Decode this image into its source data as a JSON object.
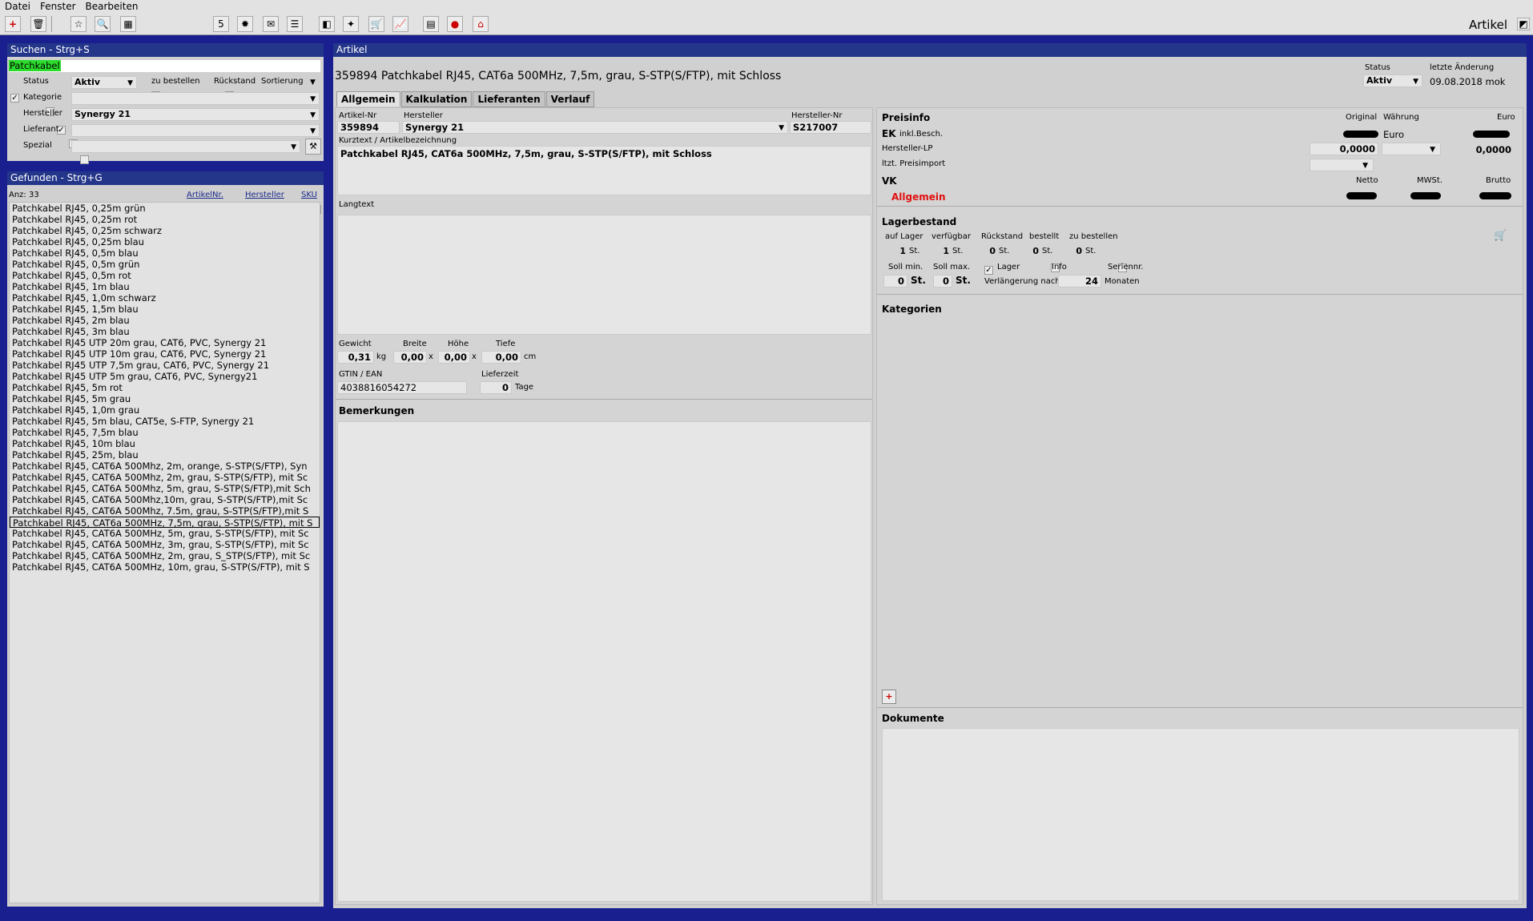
{
  "menu": [
    "Datei",
    "Fenster",
    "Bearbeiten"
  ],
  "app_title": "Artikel",
  "search": {
    "header": "Suchen - Strg+S",
    "query": "Patchkabel",
    "status_label": "Status",
    "status_value": "Aktiv",
    "zu_bestellen": "zu bestellen",
    "rueckstand": "Rückstand",
    "sortierung": "Sortierung",
    "kategorie": "Kategorie",
    "hersteller": "Hersteller",
    "hersteller_value": "Synergy 21",
    "lieferant": "Lieferant",
    "spezial": "Spezial"
  },
  "found": {
    "header": "Gefunden - Strg+G",
    "count": "Anz: 33",
    "col_artnr": "ArtikelNr.",
    "col_hersteller": "Hersteller",
    "col_sku": "SKU",
    "items": [
      "Patchkabel RJ45, 0,25m grün",
      "Patchkabel RJ45, 0,25m rot",
      "Patchkabel RJ45, 0,25m schwarz",
      "Patchkabel RJ45, 0,25m blau",
      "Patchkabel RJ45, 0,5m blau",
      "Patchkabel RJ45, 0,5m grün",
      "Patchkabel RJ45, 0,5m rot",
      "Patchkabel RJ45, 1m blau",
      "Patchkabel RJ45, 1,0m schwarz",
      "Patchkabel RJ45, 1,5m blau",
      "Patchkabel RJ45, 2m blau",
      "Patchkabel RJ45, 3m blau",
      "Patchkabel RJ45 UTP 20m grau, CAT6, PVC, Synergy 21",
      "Patchkabel RJ45 UTP 10m grau, CAT6, PVC, Synergy 21",
      "Patchkabel RJ45 UTP 7,5m grau, CAT6, PVC, Synergy 21",
      "Patchkabel RJ45 UTP 5m grau, CAT6, PVC, Synergy21",
      "Patchkabel RJ45, 5m rot",
      "Patchkabel RJ45, 5m grau",
      "Patchkabel RJ45, 1,0m grau",
      "Patchkabel RJ45, 5m blau, CAT5e, S-FTP, Synergy 21",
      "Patchkabel RJ45, 7,5m blau",
      "Patchkabel RJ45, 10m blau",
      "Patchkabel RJ45, 25m, blau",
      "Patchkabel RJ45, CAT6A 500Mhz, 2m, orange, S-STP(S/FTP), Syn",
      "Patchkabel RJ45, CAT6A 500Mhz, 2m, grau, S-STP(S/FTP), mit Sc",
      "Patchkabel RJ45, CAT6A 500Mhz, 5m, grau, S-STP(S/FTP),mit Sch",
      "Patchkabel RJ45, CAT6A 500Mhz,10m, grau, S-STP(S/FTP),mit Sc",
      "Patchkabel RJ45, CAT6A 500Mhz, 7.5m, grau, S-STP(S/FTP),mit S",
      "Patchkabel RJ45, CAT6a 500MHz, 7,5m, grau, S-STP(S/FTP), mit S",
      "Patchkabel RJ45, CAT6A 500MHz, 5m, grau, S-STP(S/FTP), mit Sc",
      "Patchkabel RJ45, CAT6A 500MHz, 3m, grau, S-STP(S/FTP), mit Sc",
      "Patchkabel RJ45, CAT6A 500MHz, 2m, grau, S_STP(S/FTP), mit Sc",
      "Patchkabel RJ45, CAT6A 500MHz, 10m, grau, S-STP(S/FTP), mit S"
    ],
    "selected_index": 28
  },
  "article": {
    "header": "Artikel",
    "title": "359894 Patchkabel RJ45, CAT6a 500MHz, 7,5m, grau, S-STP(S/FTP), mit Schloss",
    "status_label": "Status",
    "status_value": "Aktiv",
    "last_change_label": "letzte Änderung",
    "last_change_value": "09.08.2018 mok",
    "tabs": [
      "Allgemein",
      "Kalkulation",
      "Lieferanten",
      "Verlauf"
    ],
    "artnr_label": "Artikel-Nr",
    "artnr": "359894",
    "hersteller_label": "Hersteller",
    "hersteller": "Synergy 21",
    "herstnr_label": "Hersteller-Nr",
    "herstnr": "S217007",
    "kurztext_label": "Kurztext / Artikelbezeichnung",
    "kurztext": "Patchkabel RJ45, CAT6a 500MHz, 7,5m, grau, S-STP(S/FTP), mit Schloss",
    "langtext_label": "Langtext",
    "gewicht_label": "Gewicht",
    "gewicht": "0,31",
    "kg": "kg",
    "breite_label": "Breite",
    "breite": "0,00",
    "hoehe_label": "Höhe",
    "hoehe": "0,00",
    "tiefe_label": "Tiefe",
    "tiefe": "0,00",
    "cm": "cm",
    "x": "x",
    "gtin_label": "GTIN / EAN",
    "gtin": "4038816054272",
    "lieferzeit_label": "Lieferzeit",
    "lieferzeit": "0",
    "tage": "Tage",
    "bemerkungen": "Bemerkungen"
  },
  "preis": {
    "title": "Preisinfo",
    "original": "Original",
    "waehrung": "Währung",
    "euro": "Euro",
    "ek": "EK",
    "inkl": "inkl.Besch.",
    "ek_currency": "Euro",
    "herst_lp": "Hersteller-LP",
    "herst_lp_value": "0,0000",
    "herst_lp_euro": "0,0000",
    "letzt_import": "ltzt. Preisimport",
    "vk": "VK",
    "netto": "Netto",
    "mwst": "MWSt.",
    "brutto": "Brutto",
    "allgemein": "Allgemein",
    "allgemein_color": "#e01010"
  },
  "lager": {
    "title": "Lagerbestand",
    "auf_lager": "auf Lager",
    "verfuegbar": "verfügbar",
    "rueckstand": "Rückstand",
    "bestellt": "bestellt",
    "zu_bestellen": "zu bestellen",
    "v_auf_lager": "1",
    "v_verfuegbar": "1",
    "v_rueckstand": "0",
    "v_bestellt": "0",
    "v_zu_bestellen": "0",
    "st": "St.",
    "soll_min": "Soll min.",
    "soll_max": "Soll max.",
    "v_soll_min": "0",
    "v_soll_max": "0",
    "lager": "Lager",
    "info": "Info",
    "seriennr": "Seriennr.",
    "verlaengerung": "Verlängerung nach",
    "v_monate": "24",
    "monate": "Monaten"
  },
  "kategorien": "Kategorien",
  "dokumente": "Dokumente"
}
